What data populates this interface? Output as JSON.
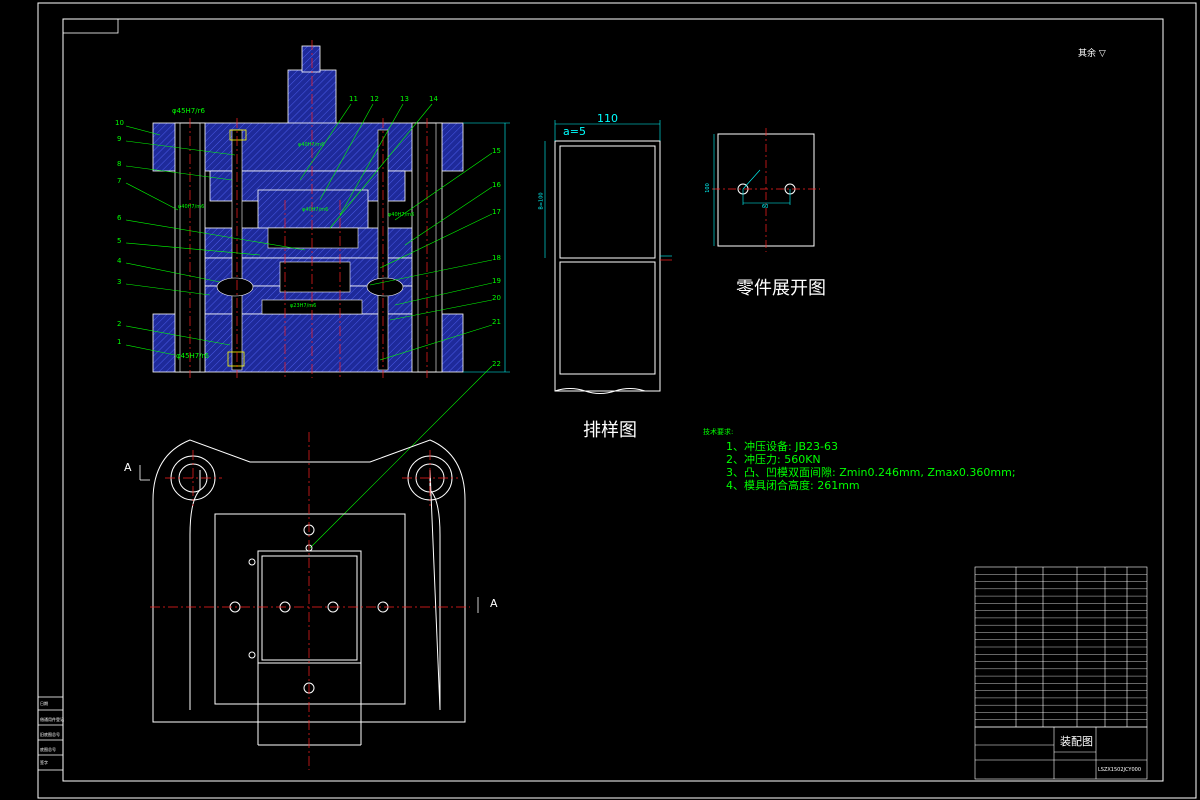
{
  "drawing": {
    "surface_mark": "其余",
    "fit_top": "φ45H7/r6",
    "fit_bottom": "φ45H7/r6",
    "fit_labels": [
      "φ40H7/m6",
      "φ40H7/m6",
      "φ40H7/m6",
      "φ40H7/m6",
      "φ23H7/m6"
    ],
    "part_numbers": [
      "1",
      "2",
      "3",
      "4",
      "5",
      "6",
      "7",
      "8",
      "9",
      "10",
      "11",
      "12",
      "13",
      "14",
      "15",
      "16",
      "17",
      "18",
      "19",
      "20",
      "21",
      "22"
    ],
    "section_a_left": "A",
    "section_a_right": "A",
    "strip_layout": {
      "title": "排样图",
      "width": "110",
      "gap": "a=5",
      "side_dim": "B=100"
    },
    "blank": {
      "title": "零件展开图",
      "dim_side": "100",
      "dim_hole": "60"
    },
    "requirements": {
      "heading": "技术要求:",
      "items": [
        "1、冲压设备: JB23-63",
        "2、冲压力: 560KN",
        "3、凸、凹模双面间隙: Zmin0.246mm, Zmax0.360mm;",
        "4、模具闭合高度: 261mm"
      ]
    },
    "title_block": {
      "name": "装配图",
      "drawing_no": "LSZX1502JCY000",
      "left_labels": [
        "借通用件登记",
        "旧底图总号",
        "底图总号",
        "签字",
        "日期"
      ]
    }
  },
  "colors": {
    "line": "#ffffff",
    "hatch": "#3b4bd8",
    "center": "#ff2020",
    "dim": "#00ffff",
    "leader": "#00ff00"
  }
}
